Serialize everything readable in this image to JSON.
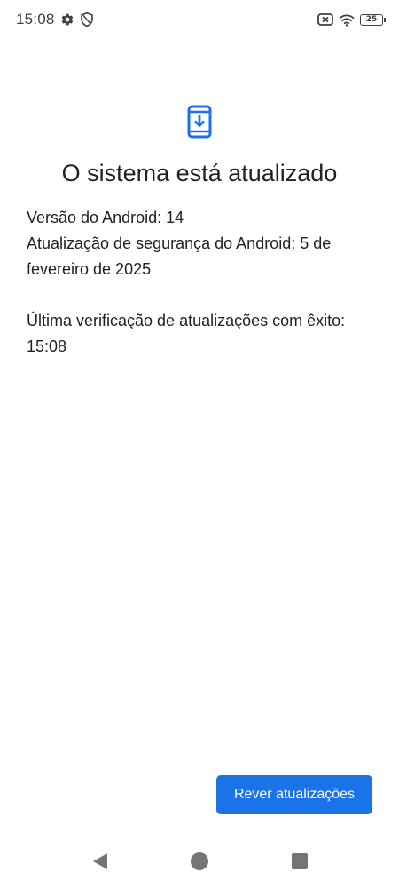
{
  "status_bar": {
    "time": "15:08",
    "battery_level": "25",
    "icons": [
      "gear-icon",
      "shield-icon",
      "no-sim-icon",
      "wifi-icon",
      "battery-icon"
    ]
  },
  "main": {
    "icon": "system-update-icon",
    "title": "O sistema está atualizado",
    "android_version": "Versão do Android: 14",
    "security_update": "Atualização de segurança do Android: 5 de fevereiro de 2025",
    "last_check_label": "Última verificação de atualizações com êxito:",
    "last_check_time": "15:08"
  },
  "actions": {
    "review_button": "Rever atualizações"
  },
  "nav_bar": {
    "icons": [
      "back-icon",
      "home-icon",
      "recents-icon"
    ]
  },
  "colors": {
    "accent": "#1a73e8",
    "text": "#202124",
    "nav": "#757575"
  }
}
